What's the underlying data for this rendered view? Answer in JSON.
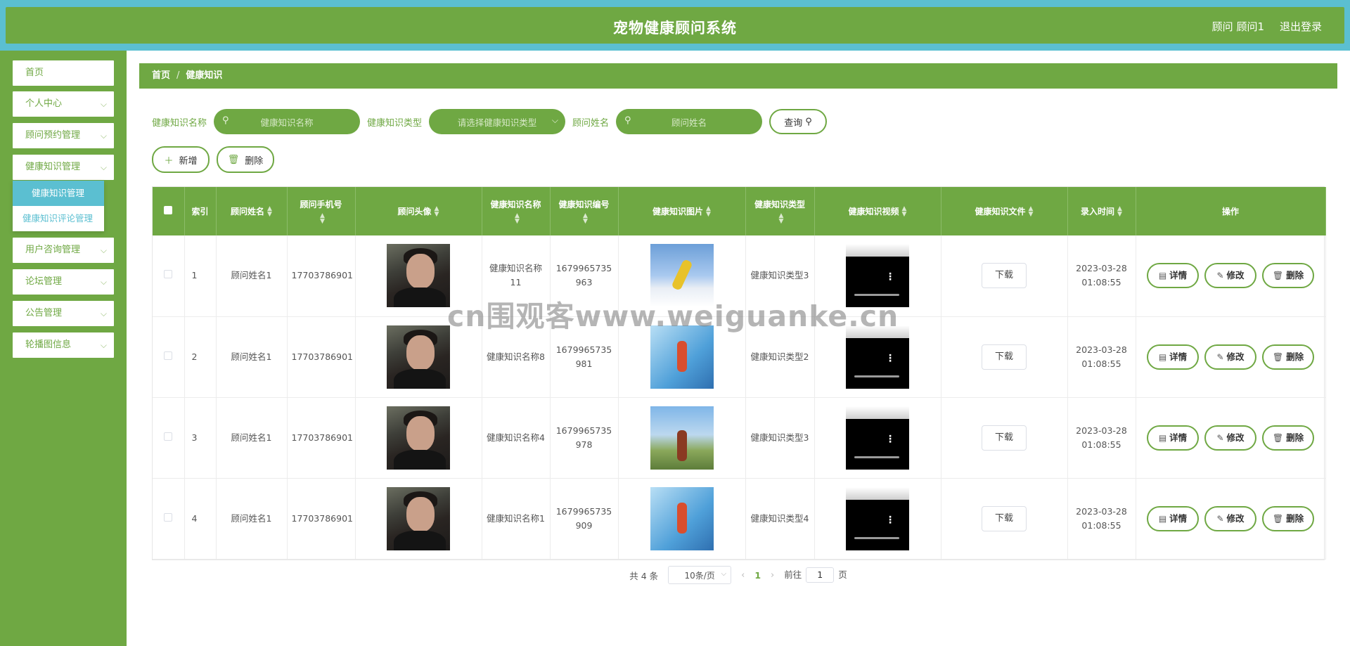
{
  "header": {
    "title": "宠物健康顾问系统",
    "user": "顾问 顾问1",
    "logout": "退出登录"
  },
  "sidebar": {
    "items": [
      {
        "label": "首页"
      },
      {
        "label": "个人中心"
      },
      {
        "label": "顾问预约管理"
      },
      {
        "label": "健康知识管理"
      },
      {
        "label": "用户咨询管理"
      },
      {
        "label": "论坛管理"
      },
      {
        "label": "公告管理"
      },
      {
        "label": "轮播图信息"
      }
    ],
    "submenu": [
      {
        "label": "健康知识管理"
      },
      {
        "label": "健康知识评论管理"
      }
    ]
  },
  "breadcrumb": {
    "home": "首页",
    "sep": "/",
    "current": "健康知识"
  },
  "search": {
    "name_label": "健康知识名称",
    "name_placeholder": "健康知识名称",
    "type_label": "健康知识类型",
    "type_placeholder": "请选择健康知识类型",
    "advisor_label": "顾问姓名",
    "advisor_placeholder": "顾问姓名",
    "query_button": "查询"
  },
  "actions": {
    "add": "新增",
    "delete": "删除"
  },
  "table": {
    "headers": [
      "索引",
      "顾问姓名",
      "顾问手机号",
      "顾问头像",
      "健康知识名称",
      "健康知识编号",
      "健康知识图片",
      "健康知识类型",
      "健康知识视频",
      "健康知识文件",
      "录入时间",
      "操作"
    ],
    "download_label": "下载",
    "op_labels": {
      "detail": "详情",
      "edit": "修改",
      "delete": "删除"
    },
    "rows": [
      {
        "index": "1",
        "advisor": "顾问姓名1",
        "phone": "17703786901",
        "name": "健康知识名称11",
        "code": "1679965735963",
        "type": "健康知识类型3",
        "time": "2023-03-28 01:08:55"
      },
      {
        "index": "2",
        "advisor": "顾问姓名1",
        "phone": "17703786901",
        "name": "健康知识名称8",
        "code": "1679965735981",
        "type": "健康知识类型2",
        "time": "2023-03-28 01:08:55"
      },
      {
        "index": "3",
        "advisor": "顾问姓名1",
        "phone": "17703786901",
        "name": "健康知识名称4",
        "code": "1679965735978",
        "type": "健康知识类型3",
        "time": "2023-03-28 01:08:55"
      },
      {
        "index": "4",
        "advisor": "顾问姓名1",
        "phone": "17703786901",
        "name": "健康知识名称1",
        "code": "1679965735909",
        "type": "健康知识类型4",
        "time": "2023-03-28 01:08:55"
      }
    ]
  },
  "pager": {
    "total": "共 4 条",
    "page_size": "10条/页",
    "current_page": "1",
    "goto_label": "前往",
    "goto_value": "1",
    "page_suffix": "页"
  },
  "watermark": "cn围观客www.weiguanke.cn",
  "colors": {
    "primary": "#6fa843",
    "accent": "#5bbfd1"
  }
}
